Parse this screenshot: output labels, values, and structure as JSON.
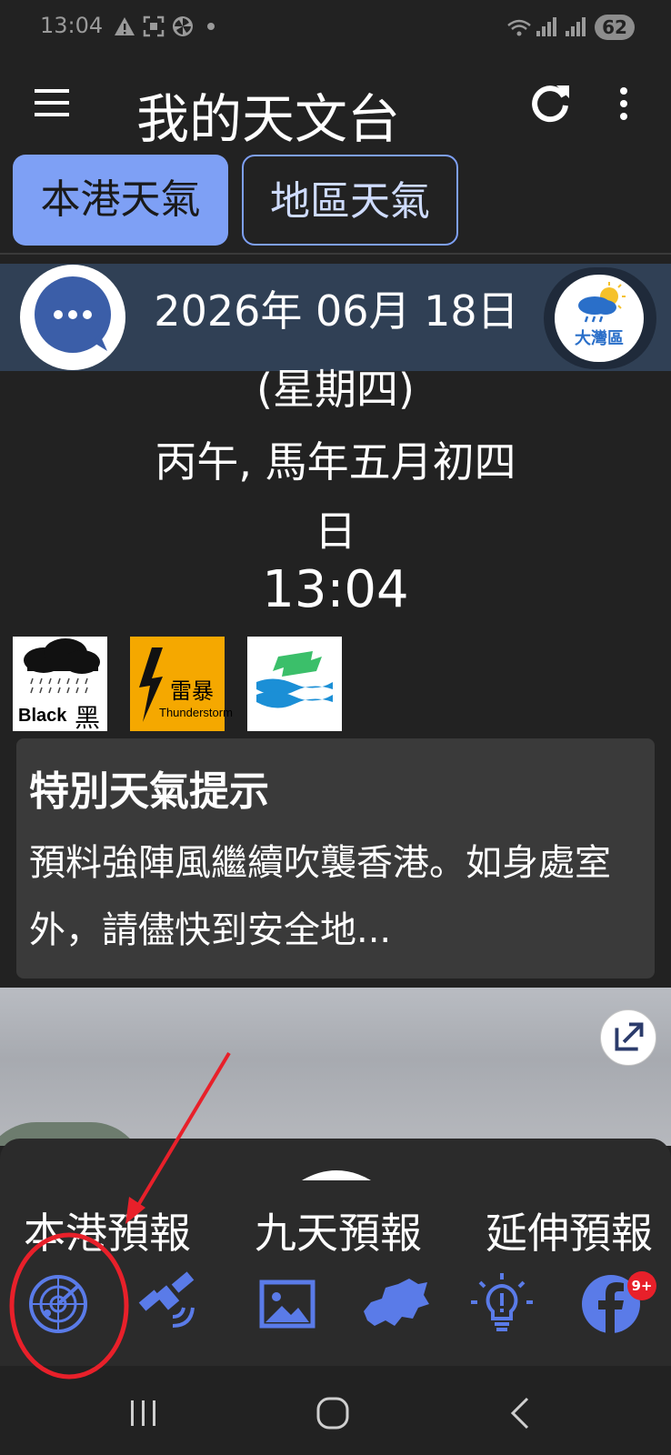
{
  "status_bar": {
    "time": "13:04",
    "battery": "62",
    "icons": [
      "warning-icon",
      "screenshot-icon",
      "pinwheel-icon",
      "dot-icon",
      "wifi-icon",
      "signal-icon",
      "signal-roaming-icon"
    ]
  },
  "app_bar": {
    "title": "我的天文台",
    "icons": [
      "menu-icon",
      "refresh-icon",
      "more-vert-icon"
    ]
  },
  "tabs": [
    {
      "label": "本港天氣",
      "selected": true
    },
    {
      "label": "地區天氣",
      "selected": false
    }
  ],
  "date_block": {
    "date": "2026年 06月 18日",
    "weekday": "(星期四)",
    "lunar_line1": "丙午, 馬年五月初四",
    "lunar_line2": "日",
    "time": "13:04",
    "gba_label": "大灣區"
  },
  "warnings": [
    {
      "name": "black-rainstorm",
      "text_en": "Black",
      "text_zh": "黑"
    },
    {
      "name": "thunderstorm",
      "text_zh": "雷暴",
      "text_en": "Thunderstorm"
    },
    {
      "name": "strong-monsoon",
      "icon": "monsoon-signal-icon"
    }
  ],
  "special_tips": {
    "title": "特別天氣提示",
    "body": "預料強陣風繼續吹襲香港。如身處室外，請儘快到安全地..."
  },
  "bottom_sheet": {
    "forecast_tabs": [
      "本港預報",
      "九天預報",
      "延伸預報"
    ],
    "tools": [
      "radar-icon",
      "satellite-icon",
      "photo-icon",
      "hk-map-icon",
      "lightbulb-icon",
      "facebook-icon"
    ],
    "facebook_badge": "9+"
  },
  "colors": {
    "background": "#222222",
    "accent": "#7ea0f5",
    "icon_blue": "#5a7be8",
    "banner": "#304055",
    "annotation_red": "#e8202a"
  }
}
